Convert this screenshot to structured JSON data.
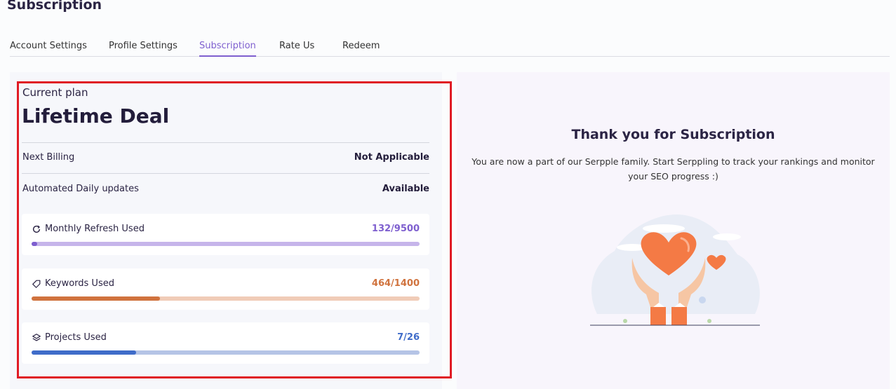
{
  "page": {
    "title": "Subscription"
  },
  "tabs": [
    {
      "label": "Account Settings",
      "active": false
    },
    {
      "label": "Profile Settings",
      "active": false
    },
    {
      "label": "Subscription",
      "active": true
    },
    {
      "label": "Rate Us",
      "active": false
    },
    {
      "label": "Redeem",
      "active": false
    }
  ],
  "plan": {
    "current_label": "Current plan",
    "name": "Lifetime Deal",
    "next_billing": {
      "label": "Next Billing",
      "value": "Not Applicable"
    },
    "daily_updates": {
      "label": "Automated Daily updates",
      "value": "Available"
    }
  },
  "usage": [
    {
      "label": "Monthly Refresh Used",
      "value": "132/9500",
      "used": 132,
      "total": 9500,
      "icon": "refresh-icon",
      "color": "#7e5fcf",
      "track": "#c6b5ea"
    },
    {
      "label": "Keywords Used",
      "value": "464/1400",
      "used": 464,
      "total": 1400,
      "icon": "tag-icon",
      "color": "#d0733e",
      "track": "#f0ccb7"
    },
    {
      "label": "Projects Used",
      "value": "7/26",
      "used": 7,
      "total": 26,
      "icon": "layers-icon",
      "color": "#3f6cc9",
      "track": "#b5c4e6"
    }
  ],
  "thanks": {
    "title": "Thank you for Subscription",
    "text": "You are now a part of our Serpple family. Start Serppling to track your rankings and monitor your SEO progress :)"
  },
  "colors": {
    "accent": "#7e5fcf",
    "highlight": "#e01b24",
    "heart": "#f47a45"
  }
}
